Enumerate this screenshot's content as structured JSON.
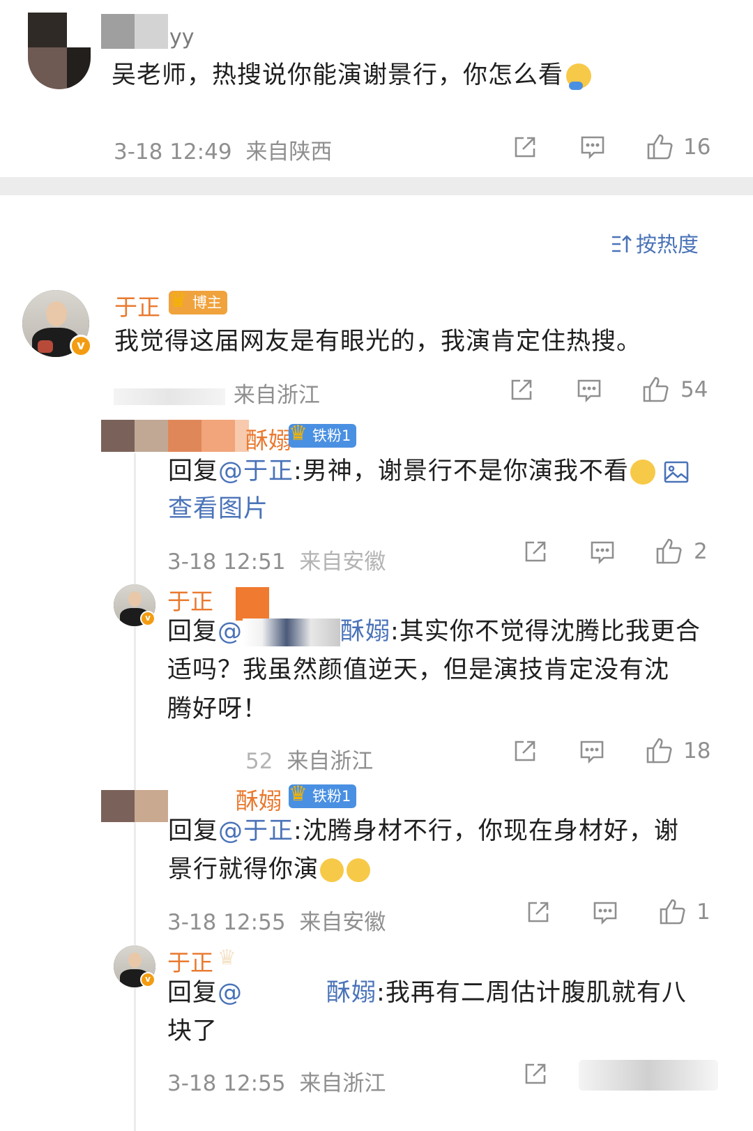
{
  "top_comment": {
    "username_partial": "yy",
    "text": "吴老师，热搜说你能演谢景行，你怎么看",
    "emoji": "thinking-emoji",
    "time": "3-18 12:49",
    "location": "来自陕西",
    "likes": "16"
  },
  "sort": {
    "label": "按热度",
    "icon": "sort-icon"
  },
  "main_comment": {
    "username": "于正",
    "badge": "博主",
    "text": "我觉得这届网友是有眼光的，我演肯定住热搜。",
    "location": "来自浙江",
    "likes": "54"
  },
  "replies": [
    {
      "username_partial": "酥嫋",
      "badge": "铁粉1",
      "prefix": "回复",
      "mention": "@于正",
      "text": ":男神，谢景行不是你演我不看",
      "view_image": "查看图片",
      "time": "3-18 12:51",
      "location": "来自安徽",
      "likes": "2"
    },
    {
      "username": "于正",
      "prefix": "回复",
      "mention_partial": "@",
      "mention_tail": "酥嫋",
      "text_line1": ":其实你不觉得沈腾比我更合",
      "text_line2": "适吗？我虽然颜值逆天，但是演技肯定没有沈",
      "text_line3": "腾好呀！",
      "time_partial": "52",
      "location": "来自浙江",
      "likes": "18"
    },
    {
      "username_partial": "酥嫋",
      "badge": "铁粉1",
      "prefix": "回复",
      "mention": "@于正",
      "text_line1": ":沈腾身材不行，你现在身材好，谢",
      "text_line2": "景行就得你演",
      "time": "3-18 12:55",
      "location": "来自安徽",
      "likes": "1"
    },
    {
      "username": "于正",
      "prefix": "回复",
      "mention_partial": "@",
      "mention_tail": "酥嫋",
      "text_line1": ":我再有二周估计腹肌就有八",
      "text_line2": "块了",
      "time": "3-18 12:55",
      "location": "来自浙江"
    }
  ],
  "colors": {
    "accent_name": "#e9792f",
    "link": "#4a73b8",
    "meta": "#8f8f8f",
    "badge_blogger": "#f0a23c",
    "badge_fan": "#4a90e2"
  }
}
